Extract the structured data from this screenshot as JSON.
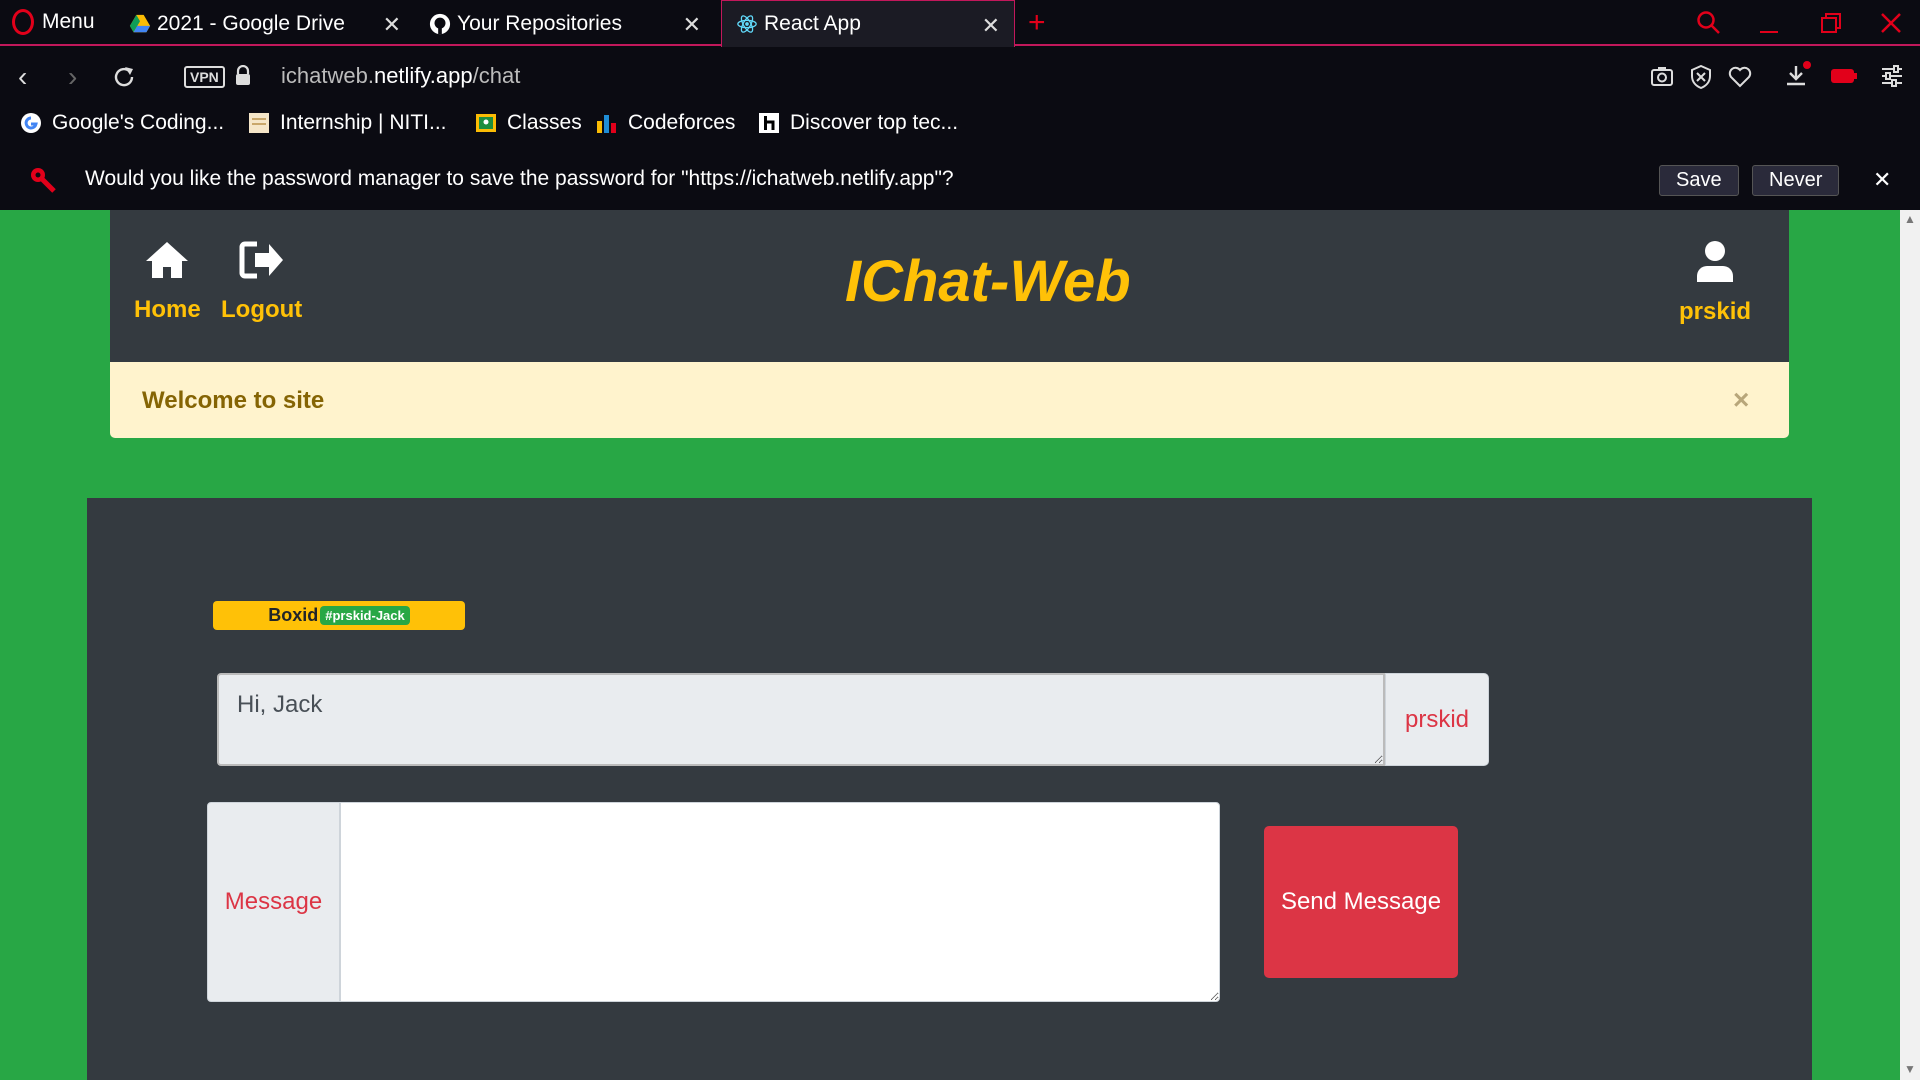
{
  "browser": {
    "menu_label": "Menu",
    "tabs": [
      {
        "title": "2021 - Google Drive"
      },
      {
        "title": "Your Repositories"
      },
      {
        "title": "React App"
      }
    ],
    "url_prefix": "ichatweb.",
    "url_host": "netlify.app",
    "url_path": "/chat",
    "vpn_label": "VPN",
    "bookmarks": [
      {
        "label": "Google's Coding..."
      },
      {
        "label": "Internship | NITI..."
      },
      {
        "label": "Classes"
      },
      {
        "label": "Codeforces"
      },
      {
        "label": "Discover top tec..."
      }
    ],
    "password_prompt": {
      "message": "Would you like the password manager to save the password for \"https://ichatweb.netlify.app\"?",
      "save_label": "Save",
      "never_label": "Never"
    }
  },
  "navbar": {
    "home_label": "Home",
    "logout_label": "Logout",
    "brand": "IChat-Web",
    "user_label": "prskid"
  },
  "alert": {
    "text": "Welcome to site",
    "close": "×"
  },
  "chat": {
    "box_label": "Boxid",
    "box_tag": "#prskid-Jack",
    "received_message": "Hi, Jack",
    "sender": "prskid",
    "message_label": "Message",
    "message_value": "",
    "send_label": "Send Message"
  },
  "colors": {
    "page_bg": "#28a745",
    "navbar_bg": "#343a40",
    "accent": "#ffc107",
    "danger": "#dc3545",
    "alert_bg": "#fff3cd"
  }
}
